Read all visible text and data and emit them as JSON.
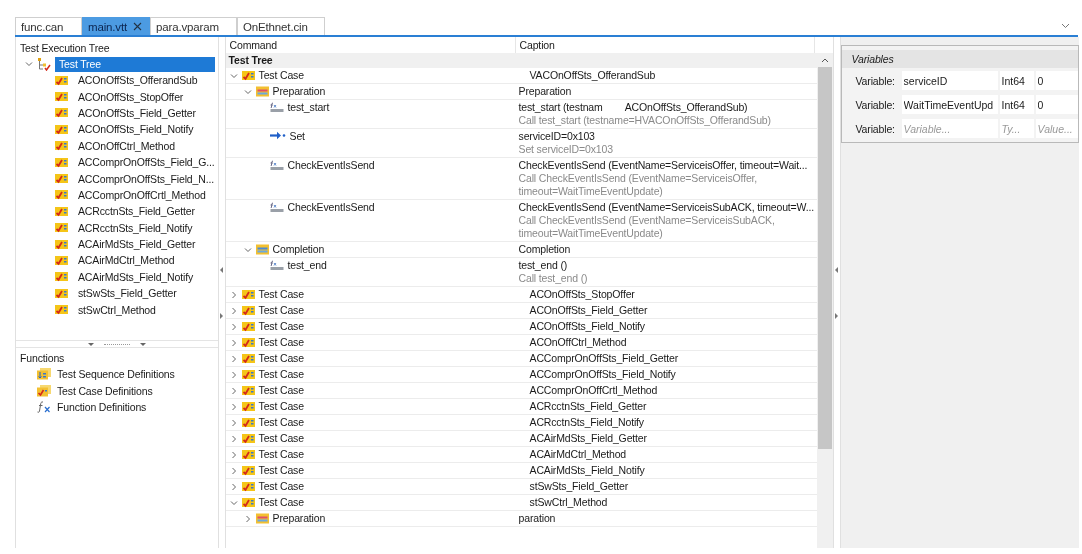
{
  "tabs": [
    {
      "label": "func.can",
      "selected": false,
      "closable": false
    },
    {
      "label": "main.vtt",
      "selected": true,
      "closable": true
    },
    {
      "label": "para.vparam",
      "selected": false,
      "closable": false
    },
    {
      "label": "OnEthnet.cin",
      "selected": false,
      "closable": false
    }
  ],
  "execution_tree": {
    "title": "Test Execution Tree",
    "root": {
      "label": "Test Tree",
      "selected": true,
      "expanded": true,
      "children": [
        "ACOnOffSts_OfferandSub",
        "ACOnOffSts_StopOffer",
        "ACOnOffSts_Field_Getter",
        "ACOnOffSts_Field_Notify",
        "ACOnOffCtrl_Method",
        "ACComprOnOffSts_Field_G...",
        "ACComprOnOffSts_Field_N...",
        "ACComprOnOffCrtl_Method",
        "ACRcctnSts_Field_Getter",
        "ACRcctnSts_Field_Notify",
        "ACAirMdSts_Field_Getter",
        "ACAirMdCtrl_Method",
        "ACAirMdSts_Field_Notify",
        "stSwSts_Field_Getter",
        "stSwCtrl_Method"
      ]
    }
  },
  "functions": {
    "title": "Functions",
    "items": [
      {
        "label": "Test Sequence Definitions",
        "kind": "sequence"
      },
      {
        "label": "Test Case Definitions",
        "kind": "testcase"
      },
      {
        "label": "Function Definitions",
        "kind": "function"
      }
    ]
  },
  "grid": {
    "columns": [
      "Command",
      "Caption"
    ],
    "group": "Test Tree",
    "rows": [
      {
        "kind": "testcase",
        "command": "Test Case",
        "caption": "VACOnOffSts_OfferandSub",
        "expanded": true,
        "children": [
          {
            "kind": "preparation",
            "command": "Preparation",
            "caption": "Preparation",
            "expanded": true,
            "children": [
              {
                "kind": "capl",
                "command": "test_start",
                "caption": "test_start (testnam",
                "caption_tail": "ACOnOffSts_OfferandSub)",
                "detail": "Call test_start (testname=HVACOnOffSts_OfferandSub)"
              },
              {
                "kind": "set",
                "command": "Set",
                "caption": "serviceID=0x103",
                "detail": "Set serviceID=0x103"
              },
              {
                "kind": "capl",
                "command": "CheckEventIsSend",
                "caption": "CheckEventIsSend (EventName=ServiceisOffer, timeout=Wait...",
                "detail": "Call CheckEventIsSend (EventName=ServiceisOffer, timeout=WaitTimeEventUpdate)"
              },
              {
                "kind": "capl",
                "command": "CheckEventIsSend",
                "caption": "CheckEventIsSend (EventName=ServiceisSubACK, timeout=W...",
                "detail": "Call CheckEventIsSend (EventName=ServiceisSubACK, timeout=WaitTimeEventUpdate)"
              }
            ]
          },
          {
            "kind": "completion",
            "command": "Completion",
            "caption": "Completion",
            "expanded": true,
            "children": [
              {
                "kind": "capl",
                "command": "test_end",
                "caption": "test_end ()",
                "detail": "Call test_end ()"
              }
            ]
          }
        ]
      },
      {
        "kind": "testcase",
        "command": "Test Case",
        "caption": "ACOnOffSts_StopOffer",
        "expanded": false
      },
      {
        "kind": "testcase",
        "command": "Test Case",
        "caption": "ACOnOffSts_Field_Getter",
        "expanded": false
      },
      {
        "kind": "testcase",
        "command": "Test Case",
        "caption": "ACOnOffSts_Field_Notify",
        "expanded": false
      },
      {
        "kind": "testcase",
        "command": "Test Case",
        "caption": "ACOnOffCtrl_Method",
        "expanded": false
      },
      {
        "kind": "testcase",
        "command": "Test Case",
        "caption": "ACComprOnOffSts_Field_Getter",
        "expanded": false
      },
      {
        "kind": "testcase",
        "command": "Test Case",
        "caption": "ACComprOnOffSts_Field_Notify",
        "expanded": false
      },
      {
        "kind": "testcase",
        "command": "Test Case",
        "caption": "ACComprOnOffCrtl_Method",
        "expanded": false
      },
      {
        "kind": "testcase",
        "command": "Test Case",
        "caption": "ACRcctnSts_Field_Getter",
        "expanded": false
      },
      {
        "kind": "testcase",
        "command": "Test Case",
        "caption": "ACRcctnSts_Field_Notify",
        "expanded": false
      },
      {
        "kind": "testcase",
        "command": "Test Case",
        "caption": "ACAirMdSts_Field_Getter",
        "expanded": false
      },
      {
        "kind": "testcase",
        "command": "Test Case",
        "caption": "ACAirMdCtrl_Method",
        "expanded": false
      },
      {
        "kind": "testcase",
        "command": "Test Case",
        "caption": "ACAirMdSts_Field_Notify",
        "expanded": false
      },
      {
        "kind": "testcase",
        "command": "Test Case",
        "caption": "stSwSts_Field_Getter",
        "expanded": false
      },
      {
        "kind": "testcase",
        "command": "Test Case",
        "caption": "stSwCtrl_Method",
        "expanded": true,
        "children": [
          {
            "kind": "preparation",
            "command": "Preparation",
            "caption": "paration",
            "expanded": false
          }
        ]
      }
    ]
  },
  "variables": {
    "title": "Variables",
    "rows": [
      {
        "label": "Variable:",
        "name": {
          "value": "serviceID"
        },
        "type": {
          "value": "Int64"
        },
        "value": {
          "value": "0"
        }
      },
      {
        "label": "Variable:",
        "name": {
          "value": "WaitTimeEventUpd"
        },
        "type": {
          "value": "Int64"
        },
        "value": {
          "value": "0"
        }
      },
      {
        "label": "Variable:",
        "name": {
          "placeholder": "Variable..."
        },
        "type": {
          "placeholder": "Ty..."
        },
        "value": {
          "placeholder": "Value..."
        }
      }
    ]
  }
}
